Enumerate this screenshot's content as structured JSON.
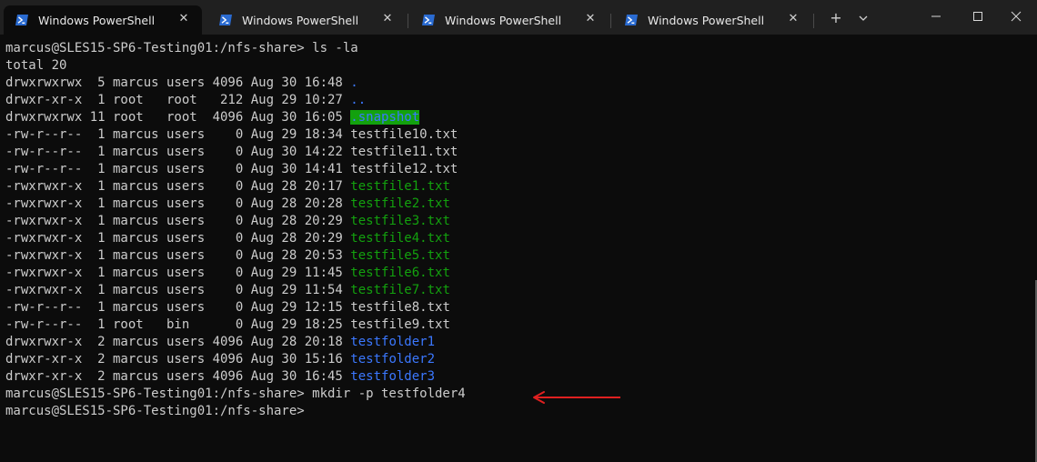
{
  "tabs": [
    {
      "label": "Windows PowerShell",
      "active": true
    },
    {
      "label": "Windows PowerShell",
      "active": false
    },
    {
      "label": "Windows PowerShell",
      "active": false
    },
    {
      "label": "Windows PowerShell",
      "active": false
    }
  ],
  "colors": {
    "background": "#0c0c0c",
    "tabstrip": "#202020",
    "text": "#cccccc",
    "directory": "#3b78ff",
    "executable": "#13a10e",
    "annotation_arrow": "#e02020"
  },
  "terminal": {
    "lines": [
      {
        "prefix": "marcus@SLES15-SP6-Testing01:/nfs-share> ls -la",
        "name": "",
        "style": "plain"
      },
      {
        "prefix": "total 20",
        "name": "",
        "style": "plain"
      },
      {
        "prefix": "drwxrwxrwx  5 marcus users 4096 Aug 30 16:48 ",
        "name": ".",
        "style": "dir"
      },
      {
        "prefix": "drwxr-xr-x  1 root   root   212 Aug 29 10:27 ",
        "name": "..",
        "style": "dir"
      },
      {
        "prefix": "drwxrwxrwx 11 root   root  4096 Aug 30 16:05 ",
        "name": ".snapshot",
        "style": "snap"
      },
      {
        "prefix": "-rw-r--r--  1 marcus users    0 Aug 29 18:34 ",
        "name": "testfile10.txt",
        "style": "plain"
      },
      {
        "prefix": "-rw-r--r--  1 marcus users    0 Aug 30 14:22 ",
        "name": "testfile11.txt",
        "style": "plain"
      },
      {
        "prefix": "-rw-r--r--  1 marcus users    0 Aug 30 14:41 ",
        "name": "testfile12.txt",
        "style": "plain"
      },
      {
        "prefix": "-rwxrwxr-x  1 marcus users    0 Aug 28 20:17 ",
        "name": "testfile1.txt",
        "style": "exe"
      },
      {
        "prefix": "-rwxrwxr-x  1 marcus users    0 Aug 28 20:28 ",
        "name": "testfile2.txt",
        "style": "exe"
      },
      {
        "prefix": "-rwxrwxr-x  1 marcus users    0 Aug 28 20:29 ",
        "name": "testfile3.txt",
        "style": "exe"
      },
      {
        "prefix": "-rwxrwxr-x  1 marcus users    0 Aug 28 20:29 ",
        "name": "testfile4.txt",
        "style": "exe"
      },
      {
        "prefix": "-rwxrwxr-x  1 marcus users    0 Aug 28 20:53 ",
        "name": "testfile5.txt",
        "style": "exe"
      },
      {
        "prefix": "-rwxrwxr-x  1 marcus users    0 Aug 29 11:45 ",
        "name": "testfile6.txt",
        "style": "exe"
      },
      {
        "prefix": "-rwxrwxr-x  1 marcus users    0 Aug 29 11:54 ",
        "name": "testfile7.txt",
        "style": "exe"
      },
      {
        "prefix": "-rw-r--r--  1 marcus users    0 Aug 29 12:15 ",
        "name": "testfile8.txt",
        "style": "plain"
      },
      {
        "prefix": "-rw-r--r--  1 root   bin      0 Aug 29 18:25 ",
        "name": "testfile9.txt",
        "style": "plain"
      },
      {
        "prefix": "drwxrwxr-x  2 marcus users 4096 Aug 28 20:18 ",
        "name": "testfolder1",
        "style": "dir"
      },
      {
        "prefix": "drwxr-xr-x  2 marcus users 4096 Aug 30 15:16 ",
        "name": "testfolder2",
        "style": "dir"
      },
      {
        "prefix": "drwxr-xr-x  2 marcus users 4096 Aug 30 16:45 ",
        "name": "testfolder3",
        "style": "dir"
      },
      {
        "prefix": "marcus@SLES15-SP6-Testing01:/nfs-share> mkdir -p testfolder4",
        "name": "",
        "style": "plain"
      },
      {
        "prefix": "marcus@SLES15-SP6-Testing01:/nfs-share> ",
        "name": "",
        "style": "plain"
      }
    ]
  }
}
